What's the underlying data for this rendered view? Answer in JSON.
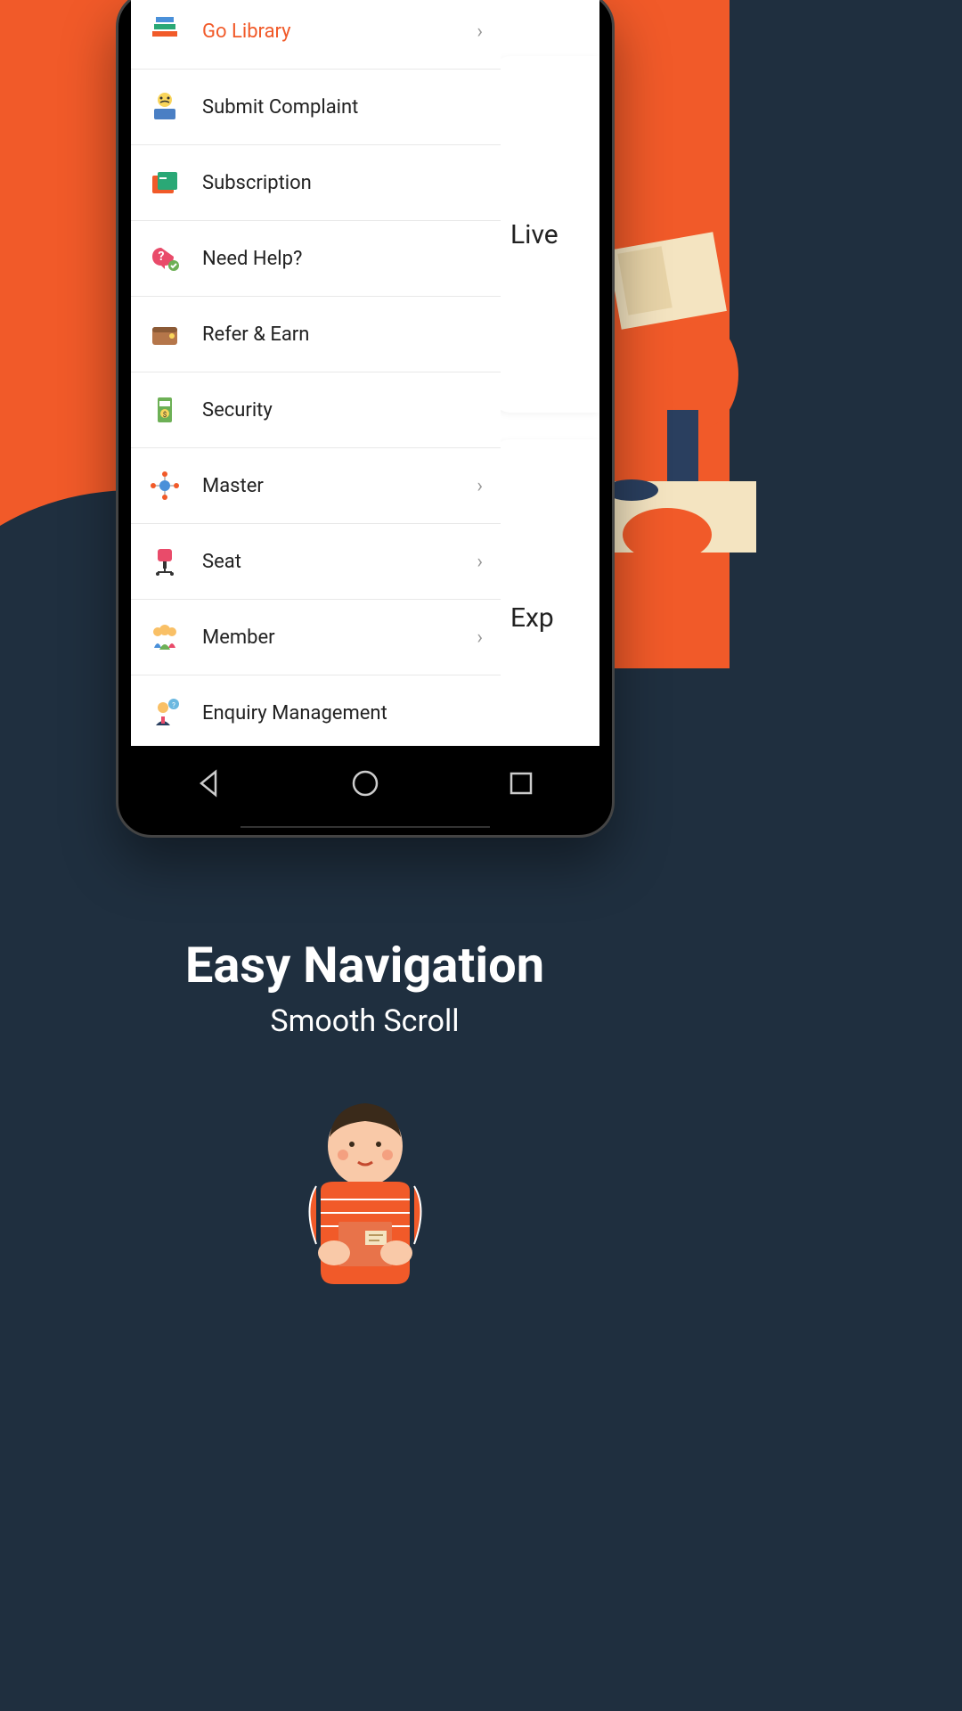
{
  "menu": {
    "items": [
      {
        "label": "Go Library",
        "highlighted": true,
        "has_chevron": true,
        "icon": "books-icon"
      },
      {
        "label": "Submit Complaint",
        "highlighted": false,
        "has_chevron": false,
        "icon": "complaint-icon"
      },
      {
        "label": "Subscription",
        "highlighted": false,
        "has_chevron": false,
        "icon": "wallet-icon"
      },
      {
        "label": "Need Help?",
        "highlighted": false,
        "has_chevron": false,
        "icon": "help-icon"
      },
      {
        "label": "Refer & Earn",
        "highlighted": false,
        "has_chevron": false,
        "icon": "refer-icon"
      },
      {
        "label": "Security",
        "highlighted": false,
        "has_chevron": false,
        "icon": "security-icon"
      },
      {
        "label": "Master",
        "highlighted": false,
        "has_chevron": true,
        "icon": "master-icon"
      },
      {
        "label": "Seat",
        "highlighted": false,
        "has_chevron": true,
        "icon": "seat-icon"
      },
      {
        "label": "Member",
        "highlighted": false,
        "has_chevron": true,
        "icon": "member-icon"
      },
      {
        "label": "Enquiry Management",
        "highlighted": false,
        "has_chevron": false,
        "icon": "enquiry-icon"
      }
    ]
  },
  "cards": {
    "card1_text": "Live",
    "card2_text": "Exp"
  },
  "headline": {
    "main": "Easy Navigation",
    "sub": "Smooth Scroll"
  }
}
